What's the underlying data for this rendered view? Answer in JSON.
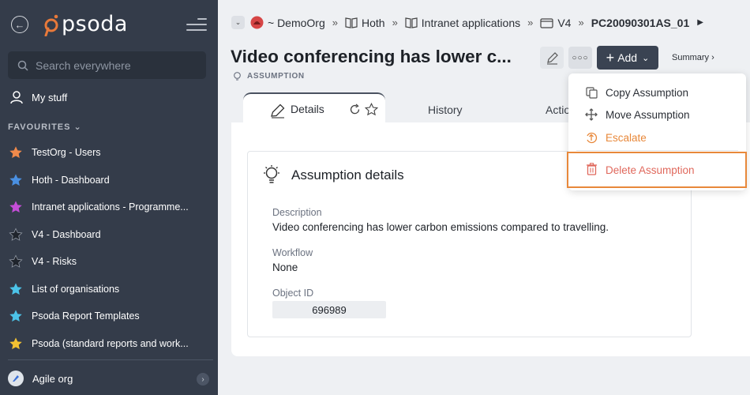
{
  "sidebar": {
    "logo_text": "psoda",
    "search_placeholder": "Search everywhere",
    "my_stuff_label": "My stuff",
    "favourites_label": "FAVOURITES",
    "favourites": [
      {
        "label": "TestOrg - Users",
        "color": "#f08a4b"
      },
      {
        "label": "Hoth - Dashboard",
        "color": "#4a90e2"
      },
      {
        "label": "Intranet applications - Programme...",
        "color": "#c44ed8"
      },
      {
        "label": "V4 - Dashboard",
        "color": "#222831"
      },
      {
        "label": "V4 - Risks",
        "color": "#222831"
      },
      {
        "label": "List of organisations",
        "color": "#4cc3e8"
      },
      {
        "label": "Psoda Report Templates",
        "color": "#4cc3e8"
      },
      {
        "label": "Psoda (standard reports and work...",
        "color": "#f2c132"
      }
    ],
    "org_label": "Agile org"
  },
  "breadcrumb": {
    "items": [
      "~ DemoOrg",
      "Hoth",
      "Intranet applications",
      "V4",
      "PC20090301AS_01"
    ],
    "separator": "»"
  },
  "header": {
    "title": "Video conferencing has lower c...",
    "type_label": "ASSUMPTION",
    "add_label": "Add",
    "summary_label": "Summary ›"
  },
  "tabs": {
    "details": "Details",
    "history": "History",
    "actions": "Actio"
  },
  "panel": {
    "title": "Assumption details",
    "fields": [
      {
        "label": "Description",
        "value": "Video conferencing has lower carbon emissions compared to travelling."
      },
      {
        "label": "Workflow",
        "value": "None"
      },
      {
        "label": "Object ID",
        "value": "696989"
      }
    ]
  },
  "menu": {
    "items": [
      {
        "label": "Copy Assumption",
        "icon": "copy-icon"
      },
      {
        "label": "Move Assumption",
        "icon": "move-icon"
      },
      {
        "label": "Escalate",
        "icon": "escalate-icon"
      }
    ],
    "delete_label": "Delete Assumption",
    "colors": {
      "escalate": "#e8883a",
      "delete": "#e0685c",
      "highlight": "#e8883a"
    }
  }
}
